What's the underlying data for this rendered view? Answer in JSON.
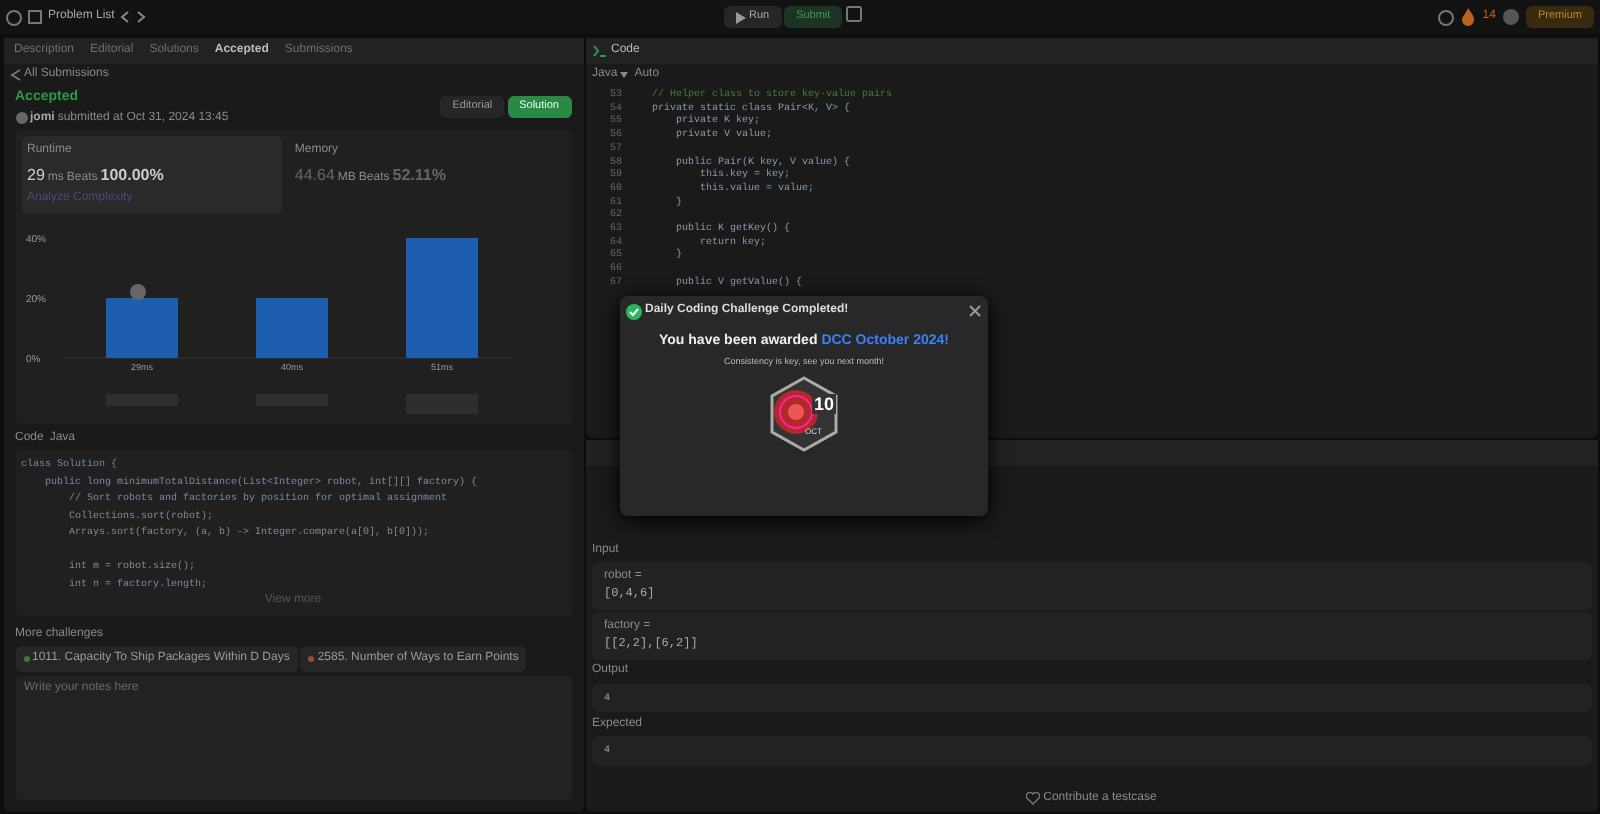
{
  "topbar": {
    "title": "Problem List",
    "run": "Run",
    "submit": "Submit",
    "streak": "14",
    "premium": "Premium"
  },
  "left_tabs": [
    {
      "label": "Description",
      "selected": false
    },
    {
      "label": "Editorial",
      "selected": false
    },
    {
      "label": "Solutions",
      "selected": false
    },
    {
      "label": "Accepted",
      "selected": true
    },
    {
      "label": "Submissions",
      "selected": false
    }
  ],
  "back_link": "All Submissions",
  "result": {
    "status": "Accepted",
    "user": "jomi",
    "submitted": "submitted at Oct 31, 2024 13:45",
    "editorial": "Editorial",
    "solution": "Solution"
  },
  "runtime": {
    "label": "Runtime",
    "value": "29",
    "unit": "ms",
    "beats_label": "Beats",
    "beats": "100.00%",
    "analyze": "Analyze Complexity"
  },
  "memory": {
    "label": "Memory",
    "value": "44.64",
    "unit": "MB",
    "beats_label": "Beats",
    "beats": "52.11%"
  },
  "chart_data": {
    "type": "bar",
    "categories": [
      "29ms",
      "40ms",
      "51ms"
    ],
    "values": [
      20,
      20,
      40
    ],
    "ylim": [
      0,
      40
    ],
    "yticks": [
      {
        "value": 0,
        "label": "0%"
      },
      {
        "value": 20,
        "label": "20%"
      },
      {
        "value": 40,
        "label": "40%"
      }
    ]
  },
  "code_header": {
    "label": "Code",
    "language": "Java"
  },
  "solution_code": [
    {
      "text": "class Solution {"
    },
    {
      "text": "    public long minimumTotalDistance(List<Integer> robot, int[][] factory) {"
    },
    {
      "text": "        // Sort robots and factories by position for optimal assignment"
    },
    {
      "text": "        Collections.sort(robot);"
    },
    {
      "text": "        Arrays.sort(factory, (a, b) -> Integer.compare(a[0], b[0]));"
    },
    {
      "text": "        int m = robot.size();",
      "blank_before": true
    },
    {
      "text": "        int n = factory.length;"
    }
  ],
  "view_more": "View more",
  "more_challenges": {
    "title": "More challenges",
    "items": [
      "1011. Capacity To Ship Packages Within D Days",
      "2585. Number of Ways to Earn Points"
    ]
  },
  "notes": {
    "placeholder": "Write your notes here"
  },
  "editor": {
    "title": "Code",
    "language": "Java",
    "mode": "Auto",
    "lines": [
      {
        "number": "53",
        "text": "    // Helper class to store key-value pairs"
      },
      {
        "number": "54",
        "text": "    private static class Pair<K, V> {"
      },
      {
        "number": "55",
        "text": "        private K key;"
      },
      {
        "number": "56",
        "text": "        private V value;"
      },
      {
        "number": "57"
      },
      {
        "number": "58",
        "text": "        public Pair(K key, V value) {"
      },
      {
        "number": "59",
        "text": "            this.key = key;"
      },
      {
        "number": "60",
        "text": "            this.value = value;"
      },
      {
        "number": "61",
        "text": "        }"
      },
      {
        "number": "62"
      },
      {
        "number": "63",
        "text": "        public K getKey() {"
      },
      {
        "number": "64",
        "text": "            return key;"
      },
      {
        "number": "65",
        "text": "        }"
      },
      {
        "number": "66"
      },
      {
        "number": "67",
        "text": "        public V getValue() {"
      }
    ]
  },
  "testcase": {
    "input_label": "Input",
    "inputs": [
      {
        "name": "robot =",
        "value": "[0,4,6]"
      },
      {
        "name": "factory =",
        "value": "[[2,2],[6,2]]"
      }
    ],
    "output_label": "Output",
    "output": "4",
    "expected_label": "Expected",
    "expected": "4",
    "contribute": "Contribute a testcase"
  },
  "modal": {
    "title": "Daily Coding Challenge Completed!",
    "message_start": "You have been awarded ",
    "award": "DCC October 2024!",
    "subtitle": "Consistency is key, see you next month!",
    "badge_day": "10",
    "badge_month": "OCT"
  }
}
